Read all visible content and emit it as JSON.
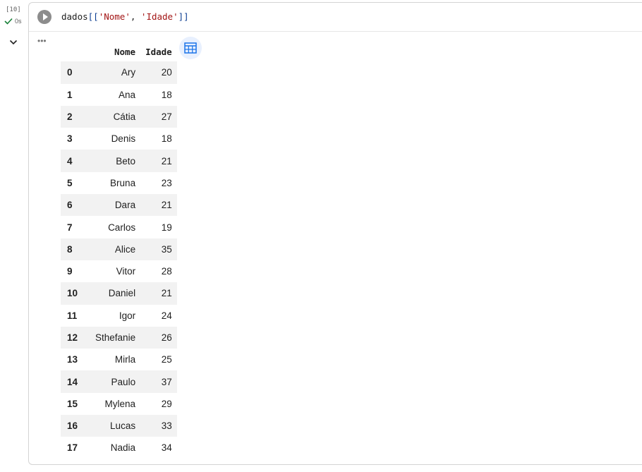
{
  "cell": {
    "execution_count": "[10]",
    "status_time": "0s",
    "code": {
      "var": "dados",
      "open": "[[",
      "str1": "'Nome'",
      "sep": ", ",
      "str2": "'Idade'",
      "close": "]]"
    }
  },
  "output": {
    "menu_glyph": "•••",
    "columns": [
      "Nome",
      "Idade"
    ],
    "rows": [
      {
        "index": "0",
        "nome": "Ary",
        "idade": "20"
      },
      {
        "index": "1",
        "nome": "Ana",
        "idade": "18"
      },
      {
        "index": "2",
        "nome": "Cátia",
        "idade": "27"
      },
      {
        "index": "3",
        "nome": "Denis",
        "idade": "18"
      },
      {
        "index": "4",
        "nome": "Beto",
        "idade": "21"
      },
      {
        "index": "5",
        "nome": "Bruna",
        "idade": "23"
      },
      {
        "index": "6",
        "nome": "Dara",
        "idade": "21"
      },
      {
        "index": "7",
        "nome": "Carlos",
        "idade": "19"
      },
      {
        "index": "8",
        "nome": "Alice",
        "idade": "35"
      },
      {
        "index": "9",
        "nome": "Vitor",
        "idade": "28"
      },
      {
        "index": "10",
        "nome": "Daniel",
        "idade": "21"
      },
      {
        "index": "11",
        "nome": "Igor",
        "idade": "24"
      },
      {
        "index": "12",
        "nome": "Sthefanie",
        "idade": "26"
      },
      {
        "index": "13",
        "nome": "Mirla",
        "idade": "25"
      },
      {
        "index": "14",
        "nome": "Paulo",
        "idade": "37"
      },
      {
        "index": "15",
        "nome": "Mylena",
        "idade": "29"
      },
      {
        "index": "16",
        "nome": "Lucas",
        "idade": "33"
      },
      {
        "index": "17",
        "nome": "Nadia",
        "idade": "34"
      }
    ]
  },
  "icons": {
    "run": "play-icon",
    "status": "checkmark-icon",
    "collapse": "chevron-down-icon",
    "output_menu": "more-horizontal-icon",
    "table_view": "table-icon"
  },
  "colors": {
    "status_check": "#188038",
    "table_icon": "#1a73e8",
    "row_stripe": "#f2f2f2"
  }
}
